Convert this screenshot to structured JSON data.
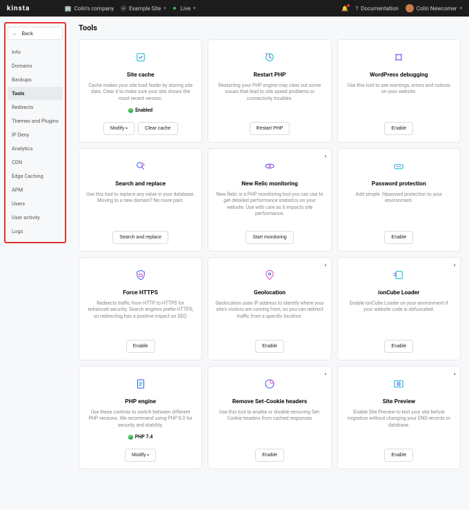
{
  "header": {
    "brand": "KINSTA",
    "company": "Colin's company",
    "site": "Example Site",
    "env": "Live",
    "docs": "Documentation",
    "user": "Colin Newcomer"
  },
  "sidebar": {
    "back": "Back",
    "items": [
      {
        "label": "Info",
        "active": false
      },
      {
        "label": "Domains",
        "active": false
      },
      {
        "label": "Backups",
        "active": false
      },
      {
        "label": "Tools",
        "active": true
      },
      {
        "label": "Redirects",
        "active": false
      },
      {
        "label": "Themes and Plugins",
        "active": false
      },
      {
        "label": "IP Deny",
        "active": false
      },
      {
        "label": "Analytics",
        "active": false
      },
      {
        "label": "CDN",
        "active": false
      },
      {
        "label": "Edge Caching",
        "active": false
      },
      {
        "label": "APM",
        "active": false
      },
      {
        "label": "Users",
        "active": false
      },
      {
        "label": "User activity",
        "active": false
      },
      {
        "label": "Logs",
        "active": false
      }
    ]
  },
  "page": {
    "title": "Tools"
  },
  "cards": [
    {
      "icon": "cache-icon",
      "title": "Site cache",
      "desc": "Cache makes your site load faster by storing site data. Clear it to make sure your site shows the most recent version.",
      "status": "Enabled",
      "actions": [
        {
          "label": "Modify",
          "chev": true
        },
        {
          "label": "Clear cache",
          "chev": false
        }
      ]
    },
    {
      "icon": "restart-icon",
      "title": "Restart PHP",
      "desc": "Restarting your PHP engine may clear out some issues that lead to site speed problems or connectivity troubles.",
      "actions": [
        {
          "label": "Restart PHP",
          "chev": false
        }
      ]
    },
    {
      "icon": "debug-icon",
      "title": "WordPress debugging",
      "desc": "Use this tool to see warnings, errors and notices on your website.",
      "actions": [
        {
          "label": "Enable",
          "chev": false
        }
      ]
    },
    {
      "icon": "search-replace-icon",
      "title": "Search and replace",
      "desc": "Use this tool to replace any value in your database. Moving to a new domain? No more pain.",
      "actions": [
        {
          "label": "Search and replace",
          "chev": false
        }
      ]
    },
    {
      "icon": "newrelic-icon",
      "title": "New Relic monitoring",
      "desc": "New Relic is a PHP monitoring tool you can use to get detailed performance statistics on your website. Use with care as it impacts site performance.",
      "premium": true,
      "actions": [
        {
          "label": "Start monitoring",
          "chev": false
        }
      ]
    },
    {
      "icon": "password-icon",
      "title": "Password protection",
      "desc": "Add simple .htpasswd protection to your environment.",
      "actions": [
        {
          "label": "Enable",
          "chev": false
        }
      ]
    },
    {
      "icon": "https-icon",
      "title": "Force HTTPS",
      "desc": "Redirects traffic from HTTP to HTTPS for enhanced security. Search engines prefer HTTPS, so redirecting has a positive impact on SEO.",
      "actions": [
        {
          "label": "Enable",
          "chev": false
        }
      ]
    },
    {
      "icon": "geo-icon",
      "title": "Geolocation",
      "desc": "Geolocation uses IP address to identify where your site's visitors are coming from, so you can redirect traffic from a specific location.",
      "premium": true,
      "actions": [
        {
          "label": "Enable",
          "chev": false
        }
      ]
    },
    {
      "icon": "ioncube-icon",
      "title": "ionCube Loader",
      "desc": "Enable ionCube Loader on your environment if your website code is obfuscated.",
      "premium": true,
      "actions": [
        {
          "label": "Enable",
          "chev": false
        }
      ]
    },
    {
      "icon": "php-icon",
      "title": "PHP engine",
      "desc": "Use these controls to switch between different PHP versions. We recommend using PHP 8.0 for security and stability.",
      "status": "PHP 7.4",
      "actions": [
        {
          "label": "Modify",
          "chev": true
        }
      ]
    },
    {
      "icon": "cookie-icon",
      "title": "Remove Set-Cookie headers",
      "desc": "Use this tool to enable or disable removing Set-Cookie headers from cached responses",
      "premium": true,
      "actions": [
        {
          "label": "Enable",
          "chev": false
        }
      ]
    },
    {
      "icon": "preview-icon",
      "title": "Site Preview",
      "desc": "Enable Site Preview to test your site before migration without changing your DNS records or database.",
      "premium": true,
      "actions": [
        {
          "label": "Enable",
          "chev": false
        }
      ]
    }
  ]
}
